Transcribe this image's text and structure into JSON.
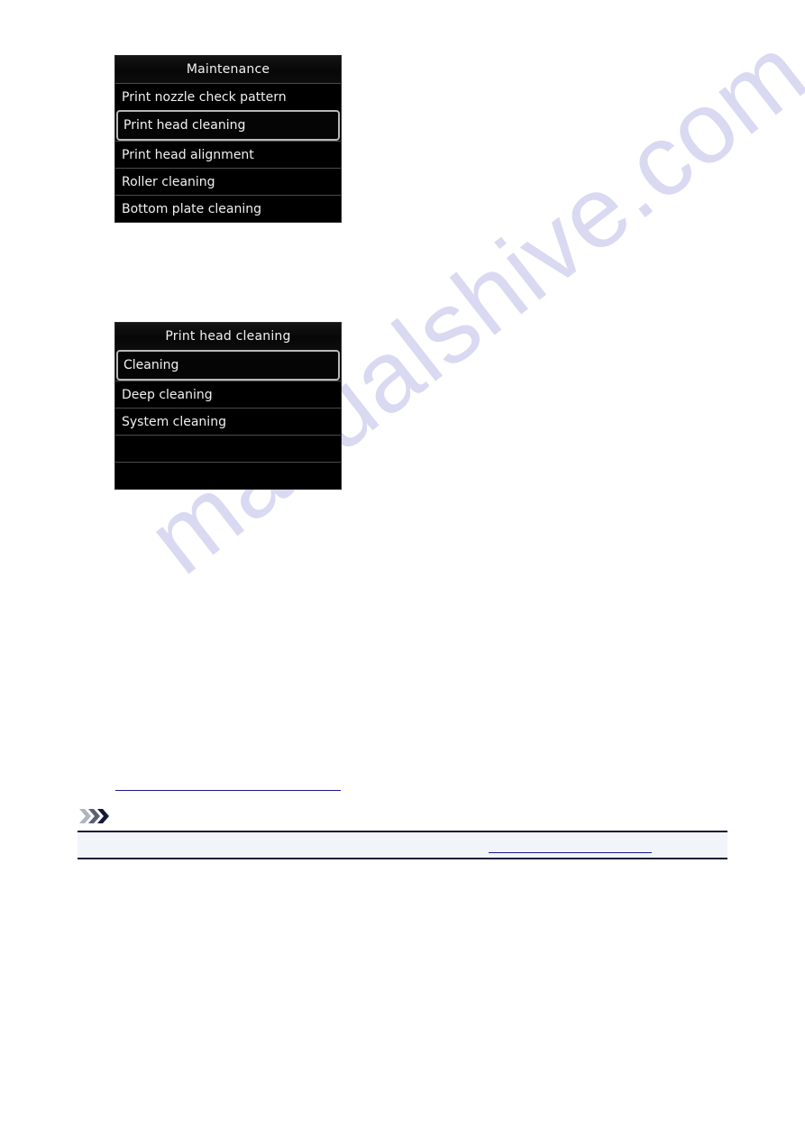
{
  "page": {
    "background_color": "#ffffff",
    "watermark_text": "manualshive.com",
    "watermark_color": "#d9d9f2"
  },
  "screens": [
    {
      "id": "maintenance",
      "title": "Maintenance",
      "selected_index": 1,
      "rows": [
        {
          "label": "Print nozzle check pattern",
          "selected": false
        },
        {
          "label": "Print head cleaning",
          "selected": true
        },
        {
          "label": "Print head alignment",
          "selected": false
        },
        {
          "label": "Roller cleaning",
          "selected": false
        },
        {
          "label": "Bottom plate cleaning",
          "selected": false
        }
      ]
    },
    {
      "id": "print-head-cleaning",
      "title": "Print head cleaning",
      "selected_index": 0,
      "rows": [
        {
          "label": "Cleaning",
          "selected": true
        },
        {
          "label": "Deep cleaning",
          "selected": false
        },
        {
          "label": "System cleaning",
          "selected": false
        },
        {
          "label": "",
          "selected": false
        },
        {
          "label": "",
          "selected": false
        }
      ]
    }
  ],
  "links": {
    "body_link_label": "",
    "note_link_label": ""
  },
  "note": {
    "marker_icon": "triple-chevron-icon",
    "text": "",
    "background_color": "#f1f4f8",
    "border_color": "#181838"
  },
  "colors": {
    "lcd_background": "#000000",
    "lcd_text": "#f0f0f0",
    "selection_highlight": "#f03030",
    "selection_inner_border": "#b9b9b9",
    "link": "#1a1a8c"
  }
}
